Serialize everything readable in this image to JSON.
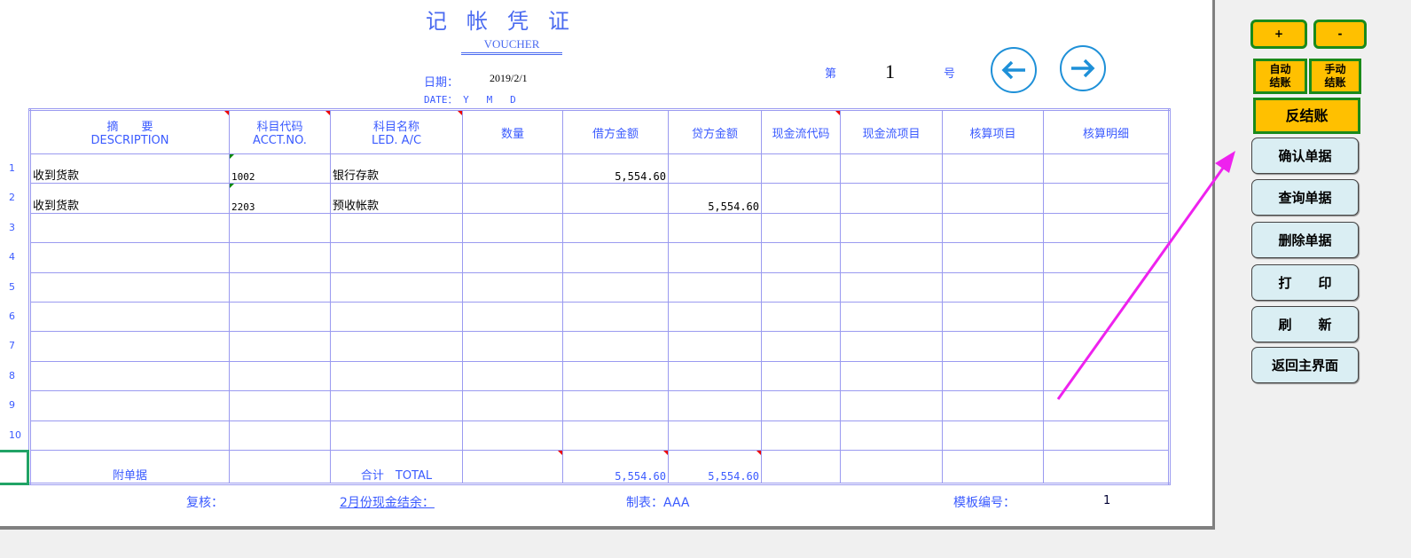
{
  "header": {
    "title": "记帐凭证",
    "subtitle": "VOUCHER",
    "date_label": "日期：",
    "date_value": "2019/2/1",
    "date_en_label": "DATE： Y   M   D",
    "no_prefix": "第",
    "no_value": "1",
    "no_suffix": "号"
  },
  "nav": {
    "prev_icon": "arrow-left-icon",
    "next_icon": "arrow-right-icon"
  },
  "table": {
    "columns": [
      {
        "cn": "摘　　要",
        "en": "DESCRIPTION"
      },
      {
        "cn": "科目代码",
        "en": "ACCT.NO."
      },
      {
        "cn": "科目名称",
        "en": "LED. A/C"
      },
      {
        "cn": "数量",
        "en": ""
      },
      {
        "cn": "借方金额",
        "en": ""
      },
      {
        "cn": "贷方金额",
        "en": ""
      },
      {
        "cn": "现金流代码",
        "en": ""
      },
      {
        "cn": "现金流项目",
        "en": ""
      },
      {
        "cn": "核算项目",
        "en": ""
      },
      {
        "cn": "核算明细",
        "en": ""
      }
    ],
    "rows": [
      {
        "no": "1",
        "desc": "收到货款",
        "code": "1002",
        "name": "银行存款",
        "qty": "",
        "debit": "5,554.60",
        "credit": ""
      },
      {
        "no": "2",
        "desc": "收到货款",
        "code": "2203",
        "name": "预收帐款",
        "qty": "",
        "debit": "",
        "credit": "5,554.60"
      },
      {
        "no": "3"
      },
      {
        "no": "4"
      },
      {
        "no": "5"
      },
      {
        "no": "6"
      },
      {
        "no": "7"
      },
      {
        "no": "8"
      },
      {
        "no": "9"
      },
      {
        "no": "10"
      }
    ],
    "total": {
      "attach_label": "附单据",
      "total_label": "合计　TOTAL",
      "debit": "5,554.60",
      "credit": "5,554.60"
    }
  },
  "footer": {
    "review": "复核：",
    "cash_balance": "2月份现金结余：",
    "maker": "制表：AAA",
    "template_label": "模板编号：",
    "template_value": "1"
  },
  "panel": {
    "plus": "+",
    "minus": "-",
    "auto_close": "自动\n结账",
    "manual_close": "手动\n结账",
    "reverse_close": "反结账",
    "confirm": "确认单据",
    "query": "查询单据",
    "delete": "删除单据",
    "print": "打　　印",
    "refresh": "刷　　新",
    "back": "返回主界面"
  },
  "colors": {
    "accent_yellow": "#ffc000",
    "border_green": "#1a8a1a",
    "button_blue": "#daeef3",
    "text_blue": "#3b5bff",
    "annotation": "#ee22ee"
  }
}
